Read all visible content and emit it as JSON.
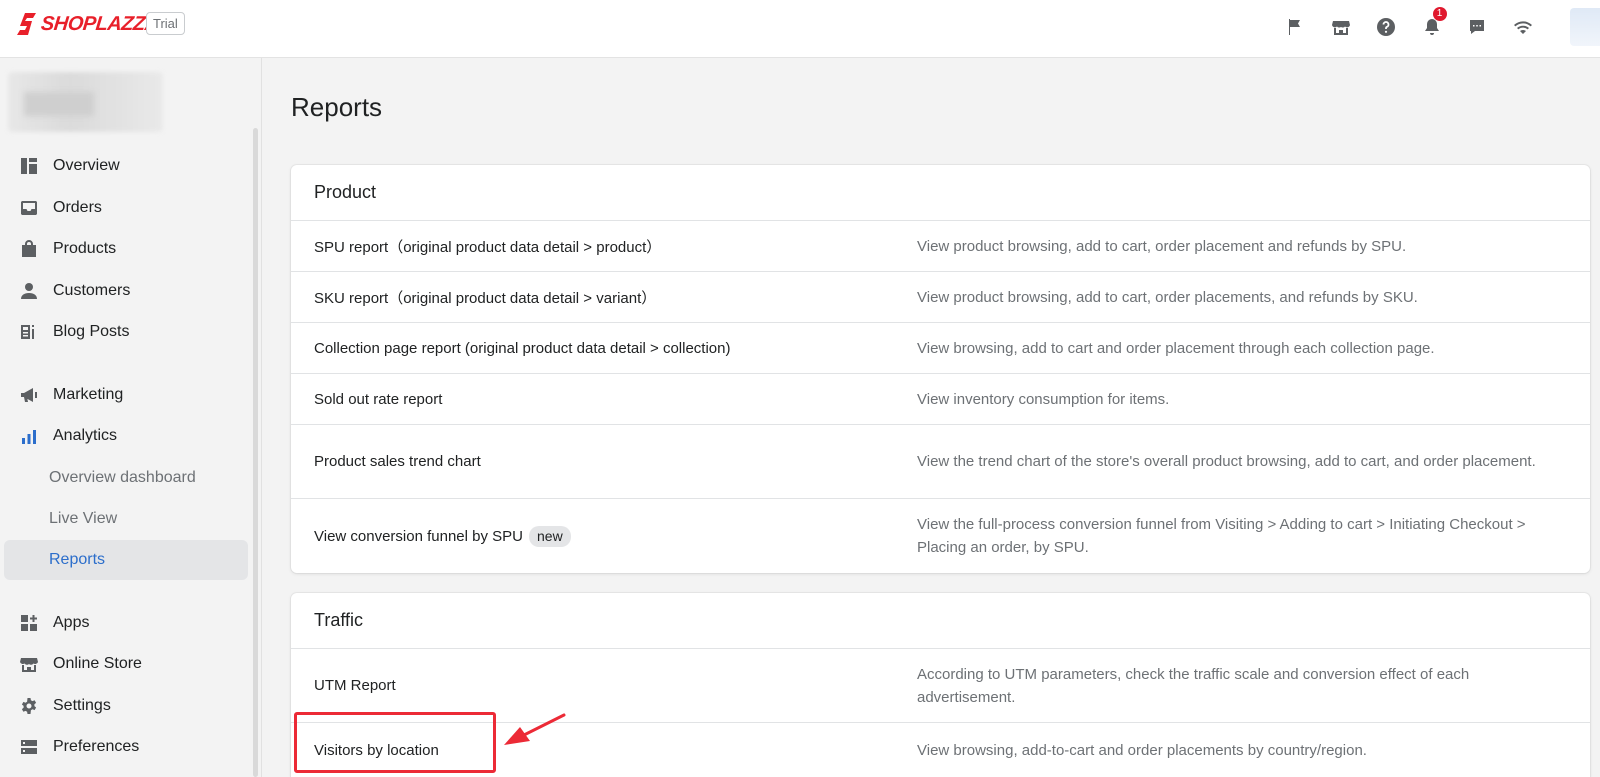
{
  "brand": {
    "name": "SHOPLAZZA",
    "trial_label": "Trial",
    "accent": "#e8202a"
  },
  "topbar": {
    "icons": [
      "flag-icon",
      "store-icon",
      "help-icon",
      "bell-icon",
      "chat-icon",
      "wifi-icon"
    ],
    "notification_count": "1"
  },
  "sidebar": {
    "items": [
      {
        "label": "Overview",
        "icon": "dashboard-icon"
      },
      {
        "label": "Orders",
        "icon": "inbox-icon"
      },
      {
        "label": "Products",
        "icon": "tag-icon"
      },
      {
        "label": "Customers",
        "icon": "person-icon"
      },
      {
        "label": "Blog Posts",
        "icon": "blog-icon"
      },
      {
        "label": "Marketing",
        "icon": "megaphone-icon"
      },
      {
        "label": "Analytics",
        "icon": "analytics-icon"
      },
      {
        "label": "Apps",
        "icon": "apps-icon"
      },
      {
        "label": "Online Store",
        "icon": "store-icon"
      },
      {
        "label": "Settings",
        "icon": "gear-icon"
      },
      {
        "label": "Preferences",
        "icon": "preferences-icon"
      }
    ],
    "analytics_sub": [
      {
        "label": "Overview dashboard"
      },
      {
        "label": "Live View"
      },
      {
        "label": "Reports",
        "active": true
      }
    ],
    "active_color": "#2c6ecb"
  },
  "main": {
    "title": "Reports",
    "sections": [
      {
        "title": "Product",
        "rows": [
          {
            "name": "SPU report（original product data detail > product）",
            "desc": "View product browsing, add to cart, order placement and refunds by SPU."
          },
          {
            "name": "SKU report（original product data detail > variant）",
            "desc": "View product browsing, add to cart, order placements, and refunds by SKU."
          },
          {
            "name": "Collection page report (original product data detail > collection)",
            "desc": "View browsing, add to cart and order placement through each collection page."
          },
          {
            "name": "Sold out rate report",
            "desc": "View inventory consumption for items."
          },
          {
            "name": "Product sales trend chart",
            "desc": "View the trend chart of the store's overall product browsing, add to cart, and order placement."
          },
          {
            "name": "View conversion funnel by SPU",
            "badge": "new",
            "desc": "View the full-process conversion funnel from Visiting > Adding to cart > Initiating Checkout > Placing an order, by SPU."
          }
        ]
      },
      {
        "title": "Traffic",
        "rows": [
          {
            "name": "UTM Report",
            "desc": "According to UTM parameters, check the traffic scale and conversion effect of each advertisement."
          },
          {
            "name": "Visitors by location",
            "desc": "View browsing, add-to-cart and order placements by country/region."
          }
        ]
      }
    ]
  },
  "annotation_color": "#ec2a36"
}
